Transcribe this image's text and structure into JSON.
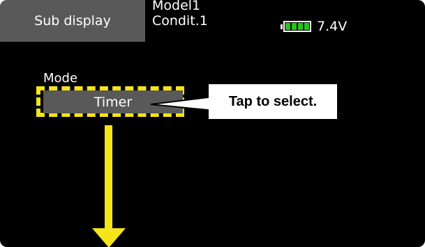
{
  "header": {
    "title": "Sub display",
    "model": "Model1",
    "condition": "Condit.1"
  },
  "battery": {
    "voltage": "7.4V",
    "level_fraction": 1.0,
    "color": "#27c41f"
  },
  "mode": {
    "label": "Mode",
    "value": "Timer"
  },
  "annotation": {
    "callout_text": "Tap to select.",
    "highlight_color": "#f5e41a",
    "arrow_color": "#f5e41a",
    "arrow_direction": "down"
  }
}
